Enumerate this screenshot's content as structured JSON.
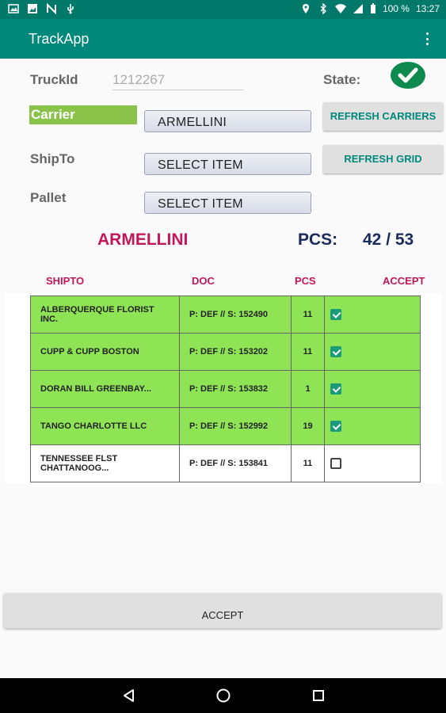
{
  "status_bar": {
    "battery": "100 %",
    "time": "13:27",
    "icons_left": [
      "gallery-icon",
      "image-icon",
      "n-icon",
      "usb-icon"
    ],
    "icons_right": [
      "location-icon",
      "bluetooth-icon",
      "wifi-icon",
      "signal-icon",
      "battery-icon"
    ]
  },
  "app_bar": {
    "title": "TrackApp",
    "menu_icon": "overflow-menu-icon"
  },
  "form": {
    "truck_label": "TruckId",
    "truck_value": "1212267",
    "state_label": "State:",
    "state_icon": "check-circle-icon",
    "carrier_label": "Carrier",
    "carrier_value": "ARMELLINI",
    "shipto_label": "ShipTo",
    "shipto_value": "SELECT ITEM",
    "pallet_label": "Pallet",
    "pallet_value": "SELECT ITEM",
    "refresh_carriers": "REFRESH CARRIERS",
    "refresh_grid": "REFRESH GRID"
  },
  "summary": {
    "carrier": "ARMELLINI",
    "pcs_label": "PCS:",
    "pcs_value": "42 / 53"
  },
  "grid": {
    "headers": {
      "shipto": "SHIPTO",
      "doc": "DOC",
      "pcs": "PCS",
      "accept": "ACCEPT"
    },
    "rows": [
      {
        "shipto": "ALBERQUERQUE FLORIST INC.",
        "doc": "P: DEF // S: 152490",
        "pcs": "11",
        "accepted": true
      },
      {
        "shipto": "CUPP & CUPP BOSTON",
        "doc": "P: DEF // S: 153202",
        "pcs": "11",
        "accepted": true
      },
      {
        "shipto": "DORAN BILL GREENBAY...",
        "doc": "P: DEF // S: 153832",
        "pcs": "1",
        "accepted": true
      },
      {
        "shipto": "TANGO CHARLOTTE LLC",
        "doc": "P: DEF // S: 152992",
        "pcs": "19",
        "accepted": true
      },
      {
        "shipto": "TENNESSEE FLST CHATTANOOG...",
        "doc": "P: DEF // S: 153841",
        "pcs": "11",
        "accepted": false
      }
    ]
  },
  "accept_button": "ACCEPT",
  "colors": {
    "accent": "#00897b",
    "highlight": "#8ee455",
    "header_text": "#c2185b",
    "summary_text": "#1a2a5a"
  },
  "nav": [
    "back-icon",
    "home-icon",
    "recents-icon"
  ]
}
